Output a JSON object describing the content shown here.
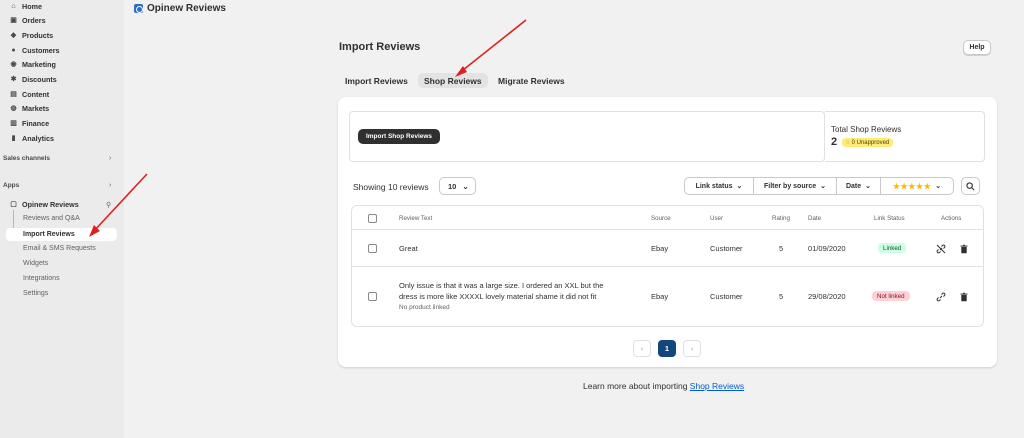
{
  "sidebar": {
    "nav": [
      {
        "label": "Home",
        "icon": "home-icon"
      },
      {
        "label": "Orders",
        "icon": "orders-icon"
      },
      {
        "label": "Products",
        "icon": "tag-icon"
      },
      {
        "label": "Customers",
        "icon": "person-icon"
      },
      {
        "label": "Marketing",
        "icon": "marketing-icon"
      },
      {
        "label": "Discounts",
        "icon": "discount-icon"
      },
      {
        "label": "Content",
        "icon": "content-icon"
      },
      {
        "label": "Markets",
        "icon": "globe-icon"
      },
      {
        "label": "Finance",
        "icon": "bank-icon"
      },
      {
        "label": "Analytics",
        "icon": "chart-icon"
      }
    ],
    "sales_channels": "Sales channels",
    "apps": "Apps",
    "app_name": "Opinew Reviews",
    "sub_items": [
      "Reviews and Q&A",
      "Import Reviews",
      "Email & SMS Requests",
      "Widgets",
      "Integrations",
      "Settings"
    ]
  },
  "topbar": {
    "app_title": "Opinew Reviews"
  },
  "header": {
    "title": "Import Reviews",
    "help": "Help"
  },
  "tabs": [
    {
      "label": "Import Reviews",
      "active": false
    },
    {
      "label": "Shop Reviews",
      "active": true
    },
    {
      "label": "Migrate Reviews",
      "active": false
    }
  ],
  "import_box": {
    "button": "Import Shop Reviews"
  },
  "totals": {
    "label": "Total Shop Reviews",
    "count": "2",
    "unapproved": "0 Unapproved"
  },
  "toolbar": {
    "showing": "Showing 10 reviews",
    "per_page": "10",
    "filters": [
      "Link status",
      "Filter by source",
      "Date"
    ],
    "stars": "★★★★★"
  },
  "table": {
    "headers": [
      "Review Text",
      "Source",
      "User",
      "Rating",
      "Date",
      "Link Status",
      "Actions"
    ],
    "rows": [
      {
        "text": "Great",
        "text2": "",
        "note": "",
        "source": "Ebay",
        "user": "Customer",
        "rating": "5",
        "date": "01/09/2020",
        "status": "Linked"
      },
      {
        "text": "Only issue is that it was a large size. I ordered an XXL but the",
        "text2": "dress is more like XXXXL lovely material shame it did not fit",
        "note": "No product linked",
        "source": "Ebay",
        "user": "Customer",
        "rating": "5",
        "date": "29/08/2020",
        "status": "Not linked"
      }
    ]
  },
  "pagination": {
    "current": "1",
    "prev": "‹",
    "next": "›"
  },
  "footer": {
    "text": "Learn more about importing",
    "link": "Shop Reviews"
  },
  "colors": {
    "primary_dark": "#303030",
    "page_active": "#12477d",
    "link": "#005bd3",
    "annotation": "#e02020"
  }
}
